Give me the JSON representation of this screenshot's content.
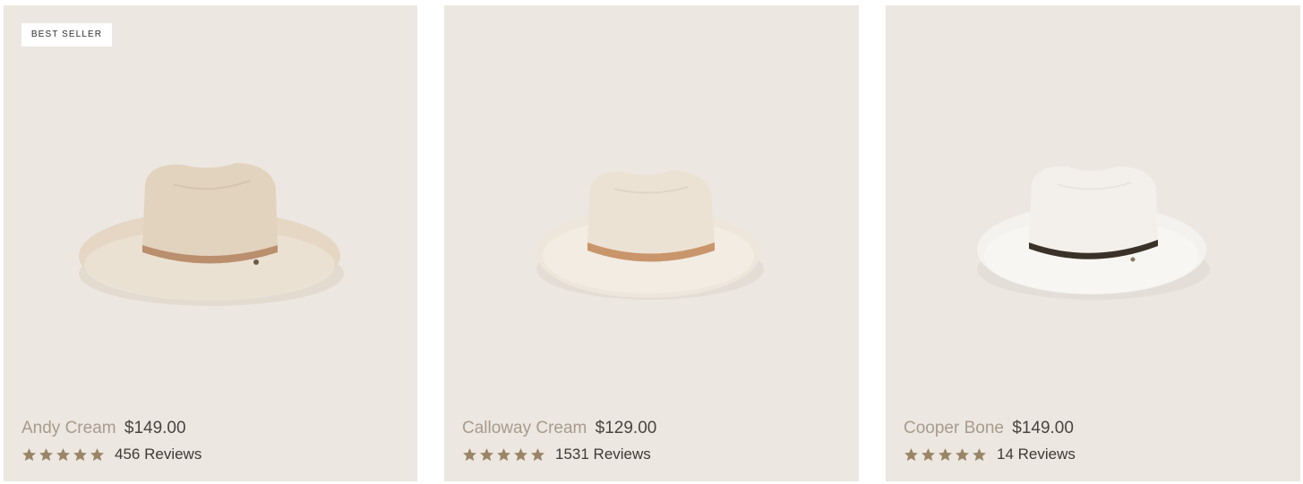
{
  "colors": {
    "card_background": "#ece7e1",
    "name_text": "#a89b8c",
    "price_text": "#4a4440",
    "star": "#9a8566"
  },
  "products": [
    {
      "badge": "BEST SELLER",
      "name": "Andy Cream",
      "price": "$149.00",
      "rating": 5,
      "reviews": "456 Reviews",
      "hat_crown": "#e2d3bf",
      "hat_brim": "#e5d7c4",
      "hat_band": "#b98f6d"
    },
    {
      "name": "Calloway Cream",
      "price": "$129.00",
      "rating": 5,
      "reviews": "1531 Reviews",
      "hat_crown": "#ebe2d4",
      "hat_brim": "#eee6da",
      "hat_band": "#c9956a"
    },
    {
      "name": "Cooper Bone",
      "price": "$149.00",
      "rating": 5,
      "reviews": "14 Reviews",
      "hat_crown": "#f3f0eb",
      "hat_brim": "#f4f2ee",
      "hat_band": "#3a3228"
    }
  ]
}
